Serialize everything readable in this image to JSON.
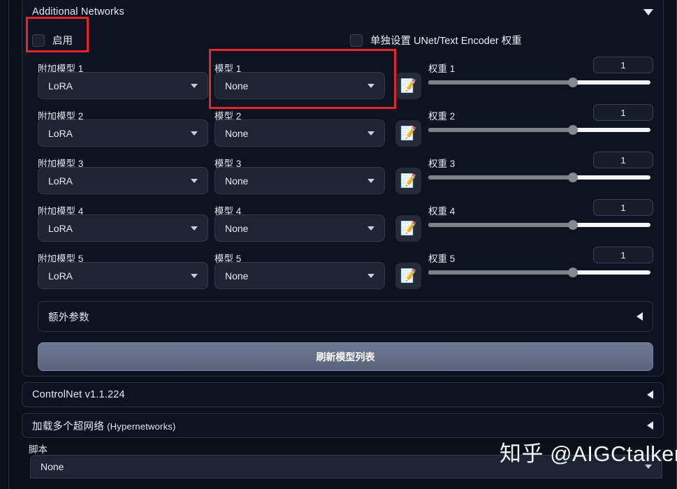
{
  "additional_networks": {
    "title": "Additional Networks",
    "collapse_icon": "chevron-down-icon",
    "enable_checkbox_label": "启用",
    "separate_weights_checkbox_label": "单独设置 UNet/Text Encoder 权重",
    "rows": [
      {
        "module_label": "附加模型 1",
        "module_value": "LoRA",
        "model_label": "模型 1",
        "model_value": "None",
        "edit_icon": "memo-pencil-icon",
        "weight_label": "权重 1",
        "weight_value": "1",
        "weight_percent": 65
      },
      {
        "module_label": "附加模型 2",
        "module_value": "LoRA",
        "model_label": "模型 2",
        "model_value": "None",
        "edit_icon": "memo-pencil-icon",
        "weight_label": "权重 2",
        "weight_value": "1",
        "weight_percent": 65
      },
      {
        "module_label": "附加模型 3",
        "module_value": "LoRA",
        "model_label": "模型 3",
        "model_value": "None",
        "edit_icon": "memo-pencil-icon",
        "weight_label": "权重 3",
        "weight_value": "1",
        "weight_percent": 65
      },
      {
        "module_label": "附加模型 4",
        "module_value": "LoRA",
        "model_label": "模型 4",
        "model_value": "None",
        "edit_icon": "memo-pencil-icon",
        "weight_label": "权重 4",
        "weight_value": "1",
        "weight_percent": 65
      },
      {
        "module_label": "附加模型 5",
        "module_value": "LoRA",
        "model_label": "模型 5",
        "model_value": "None",
        "edit_icon": "memo-pencil-icon",
        "weight_label": "权重 5",
        "weight_value": "1",
        "weight_percent": 65
      }
    ],
    "extra_params": {
      "title": "额外参数",
      "collapse_icon": "chevron-left-icon"
    },
    "refresh_button_label": "刷新模型列表"
  },
  "controlnet": {
    "title": "ControlNet v1.1.224",
    "collapse_icon": "chevron-left-icon"
  },
  "hypernetworks": {
    "title": "加载多个超网络 ",
    "title_suffix": "(Hypernetworks)",
    "collapse_icon": "chevron-left-icon"
  },
  "script": {
    "label": "脚本",
    "value": "None",
    "caret_icon": "chevron-down-icon"
  },
  "watermark": {
    "text": "知乎 @AIGCtalker"
  },
  "annotations": {
    "enable_highlight_color": "#e3262a",
    "model1_highlight_color": "#e3262a"
  }
}
